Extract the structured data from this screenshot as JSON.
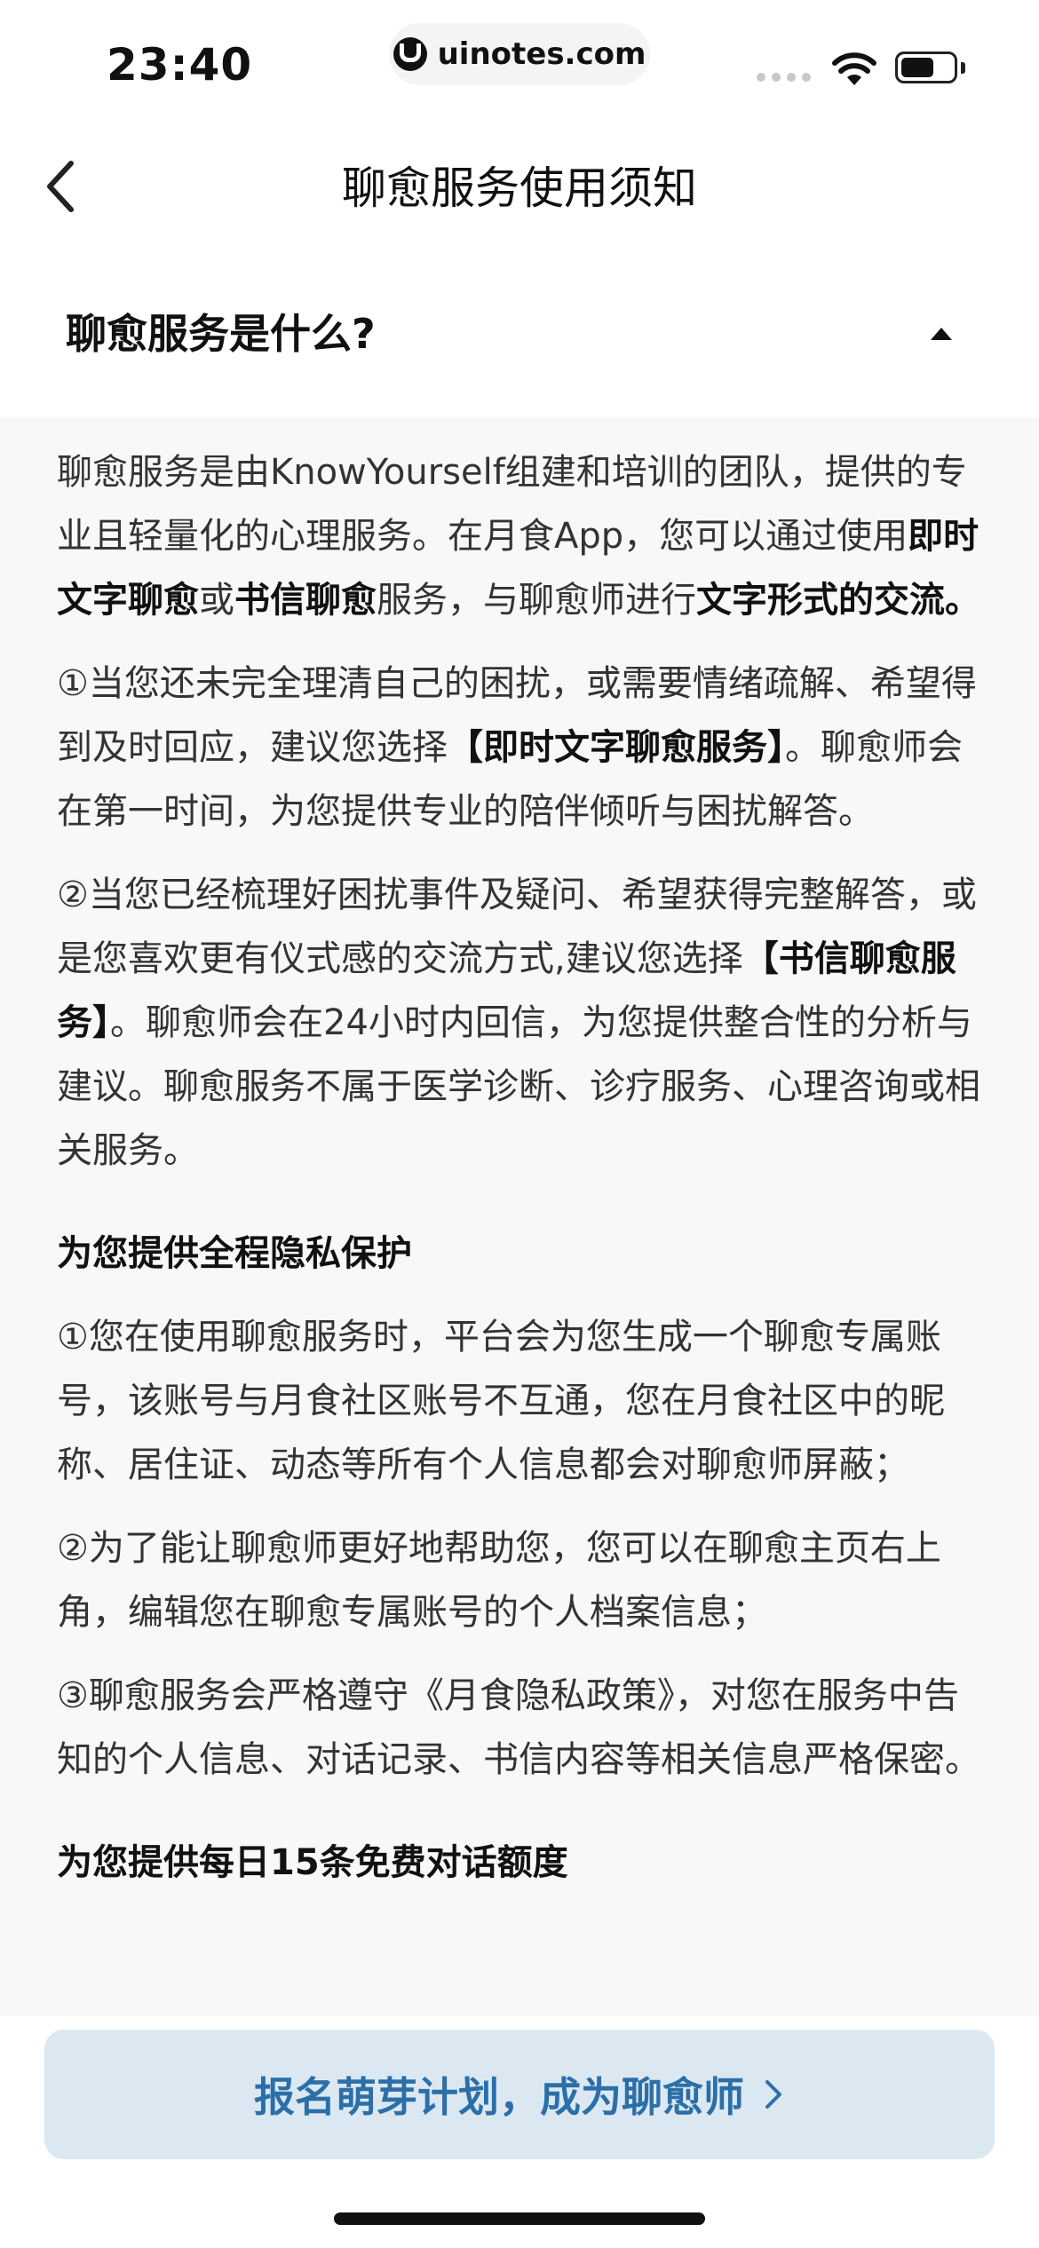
{
  "status": {
    "time": "23:40",
    "url": "uinotes.com"
  },
  "nav": {
    "title": "聊愈服务使用须知"
  },
  "section": {
    "title": "聊愈服务是什么?"
  },
  "content": {
    "intro": [
      {
        "t": "聊愈服务是由KnowYourself组建和培训的团队，提供的专业且轻量化的心理服务。在月食App，您可以通过使用"
      },
      {
        "b": "即时文字聊愈"
      },
      {
        "t": "或"
      },
      {
        "b": "书信聊愈"
      },
      {
        "t": "服务，与聊愈师进行"
      },
      {
        "b": "文字形式的交流。"
      }
    ],
    "p1": [
      {
        "t": "①当您还未完全理清自己的困扰，或需要情绪疏解、希望得到及时回应，建议您选择"
      },
      {
        "b": "【即时文字聊愈服务】"
      },
      {
        "t": "。聊愈师会在第一时间，为您提供专业的陪伴倾听与困扰解答。"
      }
    ],
    "p2": [
      {
        "t": "②当您已经梳理好困扰事件及疑问、希望获得完整解答，或是您喜欢更有仪式感的交流方式,建议您选择"
      },
      {
        "b": "【书信聊愈服务】"
      },
      {
        "t": "。聊愈师会在24小时内回信，为您提供整合性的分析与建议。聊愈服务不属于医学诊断、诊疗服务、心理咨询或相关服务。"
      }
    ],
    "privacy_title": "为您提供全程隐私保护",
    "privacy1": "①您在使用聊愈服务时，平台会为您生成一个聊愈专属账号，该账号与月食社区账号不互通，您在月食社区中的昵称、居住证、动态等所有个人信息都会对聊愈师屏蔽；",
    "privacy2": "②为了能让聊愈师更好地帮助您，您可以在聊愈主页右上角，编辑您在聊愈专属账号的个人档案信息；",
    "privacy3": "③聊愈服务会严格遵守《月食隐私政策》，对您在服务中告知的个人信息、对话记录、书信内容等相关信息严格保密。",
    "quota_title": "为您提供每日15条免费对话额度"
  },
  "cta": {
    "label": "报名萌芽计划，成为聊愈师"
  },
  "colors": {
    "cta_bg": "#dbe8f1",
    "cta_text": "#2c6fa8",
    "content_bg": "#f8f8f8"
  }
}
